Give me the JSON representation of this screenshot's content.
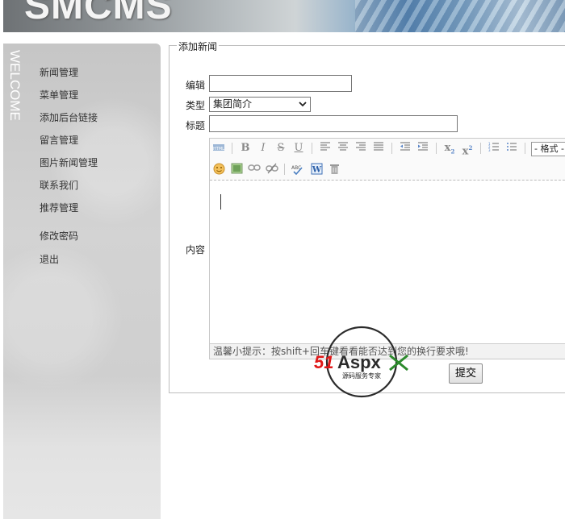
{
  "banner": {
    "logo": "SMCMS"
  },
  "sidebar": {
    "welcome": "WELCOME",
    "items": [
      {
        "label": "新闻管理"
      },
      {
        "label": "菜单管理"
      },
      {
        "label": "添加后台链接"
      },
      {
        "label": "留言管理"
      },
      {
        "label": "图片新闻管理"
      },
      {
        "label": "联系我们"
      },
      {
        "label": "推荐管理"
      },
      {
        "label": "修改密码"
      },
      {
        "label": "退出"
      }
    ]
  },
  "form": {
    "legend": "添加新闻",
    "editor_label": "编辑",
    "editor_value": "",
    "type_label": "类型",
    "type_selected": "集团简介",
    "title_label": "标题",
    "title_value": "",
    "content_label": "内容",
    "format_select": "- 格式 -",
    "tip": "温馨小提示：按shift+回车键看看能否达到您的换行要求哦!",
    "submit_label": "提交"
  },
  "toolbar_icons": [
    "source-icon",
    "bold-icon",
    "italic-icon",
    "strikethrough-icon",
    "underline-icon",
    "align-left-icon",
    "align-center-icon",
    "align-right-icon",
    "align-justify-icon",
    "outdent-icon",
    "indent-icon",
    "subscript-icon",
    "superscript-icon",
    "ordered-list-icon",
    "unordered-list-icon",
    "emoticon-icon",
    "image-icon",
    "link-icon",
    "unlink-icon",
    "spellcheck-icon",
    "paste-word-icon",
    "delete-icon"
  ],
  "watermark": {
    "text_main": "51Aspx",
    "text_sub": "源码服务专家"
  },
  "colors": {
    "watermark_red": "#e01818",
    "watermark_green": "#2c8a2c"
  }
}
